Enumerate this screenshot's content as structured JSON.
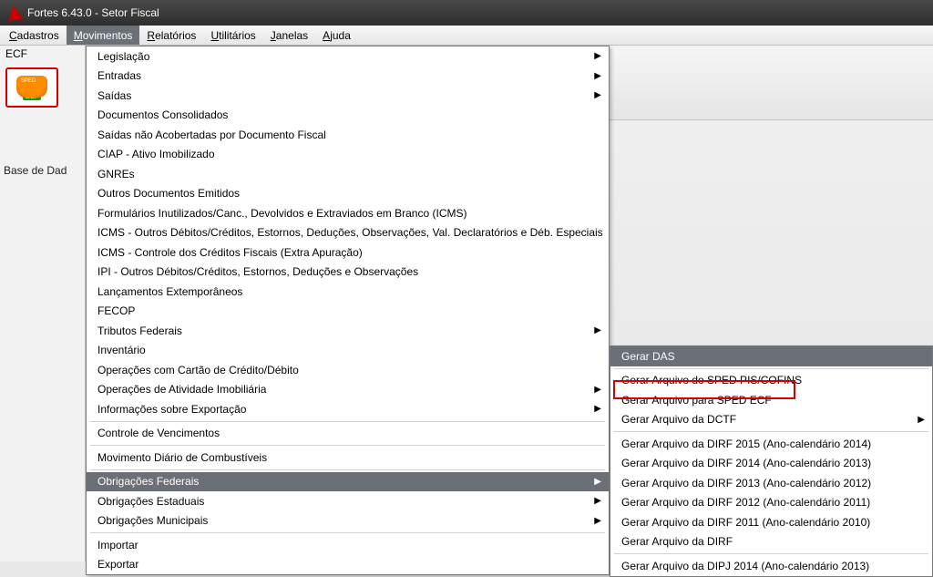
{
  "title": "Fortes 6.43.0 - Setor Fiscal",
  "menubar": {
    "items": [
      {
        "label": "Cadastros",
        "mn": "C"
      },
      {
        "label": "Movimentos",
        "mn": "M",
        "open": true
      },
      {
        "label": "Relatórios",
        "mn": "R"
      },
      {
        "label": "Utilitários",
        "mn": "U"
      },
      {
        "label": "Janelas",
        "mn": "J"
      },
      {
        "label": "Ajuda",
        "mn": "A"
      }
    ]
  },
  "sidebar": {
    "title": "ECF",
    "badge": "ECF",
    "basedados": "Base de Dad"
  },
  "dropdown1": {
    "groups": [
      [
        {
          "label": "Legislação",
          "sub": true
        },
        {
          "label": "Entradas",
          "sub": true
        },
        {
          "label": "Saídas",
          "sub": true
        },
        {
          "label": "Documentos Consolidados"
        },
        {
          "label": "Saídas não Acobertadas por Documento Fiscal"
        },
        {
          "label": "CIAP - Ativo Imobilizado"
        },
        {
          "label": "GNREs"
        },
        {
          "label": "Outros Documentos Emitidos"
        },
        {
          "label": "Formulários Inutilizados/Canc., Devolvidos e Extraviados em Branco (ICMS)"
        },
        {
          "label": "ICMS - Outros Débitos/Créditos, Estornos, Deduções, Observações, Val. Declaratórios e Déb. Especiais"
        },
        {
          "label": "ICMS - Controle dos Créditos Fiscais (Extra Apuração)"
        },
        {
          "label": "IPI - Outros Débitos/Créditos, Estornos, Deduções e Observações"
        },
        {
          "label": "Lançamentos Extemporâneos"
        },
        {
          "label": "FECOP"
        },
        {
          "label": "Tributos Federais",
          "sub": true
        },
        {
          "label": "Inventário"
        },
        {
          "label": "Operações com Cartão de Crédito/Débito"
        },
        {
          "label": "Operações de Atividade Imobiliária",
          "sub": true
        },
        {
          "label": "Informações sobre Exportação",
          "sub": true
        }
      ],
      [
        {
          "label": "Controle de Vencimentos"
        }
      ],
      [
        {
          "label": "Movimento Diário de Combustíveis"
        }
      ],
      [
        {
          "label": "Obrigações Federais",
          "sub": true,
          "hl": true
        },
        {
          "label": "Obrigações Estaduais",
          "sub": true
        },
        {
          "label": "Obrigações Municipais",
          "sub": true
        }
      ],
      [
        {
          "label": "Importar"
        },
        {
          "label": "Exportar"
        }
      ]
    ]
  },
  "dropdown2": {
    "groups": [
      [
        {
          "label": "Gerar DAS",
          "hl": true
        }
      ],
      [
        {
          "label": "Gerar Arquivo do SPED PIS/COFINS"
        },
        {
          "label": "Gerar Arquivo para SPED ECF",
          "boxed": true
        },
        {
          "label": "Gerar Arquivo da DCTF",
          "sub": true
        }
      ],
      [
        {
          "label": "Gerar Arquivo da DIRF 2015 (Ano-calendário 2014)"
        },
        {
          "label": "Gerar Arquivo da DIRF 2014 (Ano-calendário 2013)"
        },
        {
          "label": "Gerar Arquivo da DIRF 2013 (Ano-calendário 2012)"
        },
        {
          "label": "Gerar Arquivo da DIRF 2012 (Ano-calendário 2011)"
        },
        {
          "label": "Gerar Arquivo da DIRF 2011 (Ano-calendário 2010)"
        },
        {
          "label": "Gerar Arquivo da DIRF"
        }
      ],
      [
        {
          "label": "Gerar Arquivo da DIPJ 2014 (Ano-calendário 2013)"
        }
      ]
    ]
  }
}
